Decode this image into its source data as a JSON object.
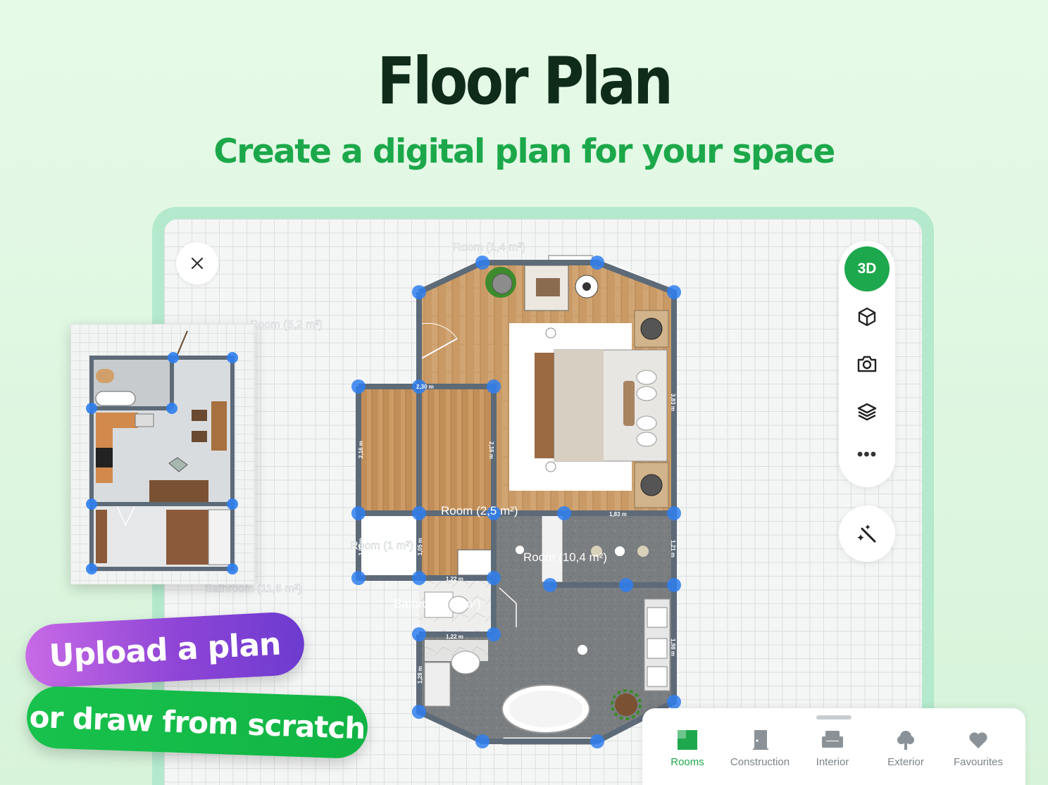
{
  "headline": "Floor Plan",
  "subline": "Create a digital plan for your space",
  "close_icon": "close-icon",
  "toolbar": {
    "btn_3d_label": "3D",
    "icons": [
      "cube-icon",
      "camera-icon",
      "layers-icon"
    ],
    "more_label": "•••",
    "magic_icon": "magic-wand-icon"
  },
  "plan": {
    "labels": {
      "room_top": "Room (1,4 m²)",
      "room_left": "Room (6,2 m²)",
      "room_center": "Room (2,5 m²)",
      "room_small": "Room (1 m²)",
      "room_bath_right": "Room (10,4 m²)",
      "bathroom": "Bathroom (11,6 m²)",
      "bath_small": "Bathroom (1 m²)"
    },
    "dimensions": {
      "d_230": "2,30 m",
      "d_216a": "2,16 m",
      "d_216b": "2,16 m",
      "d_383": "3,83 m",
      "d_183": "1,83 m",
      "d_122a": "1,22 m",
      "d_122b": "1,22 m",
      "d_105a": "1,05 m",
      "d_105b": "1,05 m",
      "d_121": "1,21 m",
      "d_128": "1,28 m",
      "d_198": "1,98 m"
    }
  },
  "pills": {
    "upload": "Upload a plan",
    "draw": "or draw from scratch"
  },
  "bottom_tabs": [
    {
      "label": "Rooms",
      "icon": "rooms-icon",
      "active": true
    },
    {
      "label": "Construction",
      "icon": "door-icon",
      "active": false
    },
    {
      "label": "Interior",
      "icon": "armchair-icon",
      "active": false
    },
    {
      "label": "Exterior",
      "icon": "tree-icon",
      "active": false
    },
    {
      "label": "Favourites",
      "icon": "heart-icon",
      "active": false
    }
  ],
  "colors": {
    "brand_green": "#1ea84d",
    "headline": "#0f2b1a",
    "upload_purple": "#8e45d6",
    "handle_blue": "#2f7ff0"
  }
}
